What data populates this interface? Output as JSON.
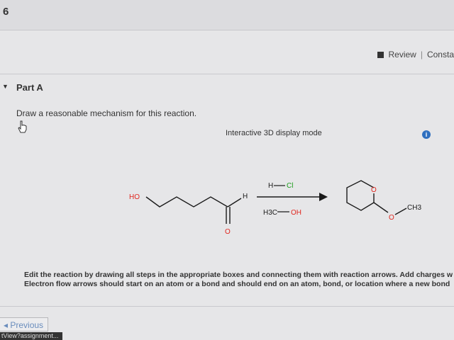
{
  "header": {
    "step_number": "6"
  },
  "toolbar": {
    "review_label": "Review",
    "separator": "|",
    "constants_label": "Consta"
  },
  "part": {
    "title": "Part A"
  },
  "question": {
    "text": "Draw a reasonable mechanism for this reaction."
  },
  "display": {
    "mode_label": "Interactive 3D display mode",
    "info_glyph": "i"
  },
  "reaction": {
    "reactant": {
      "hydroxyl": "HO",
      "aldehyde_h": "H",
      "carbonyl_o": "O"
    },
    "reagents": {
      "top_h": "H",
      "top_cl": "Cl",
      "bottom_h3c": "H3C",
      "bottom_oh": "OH"
    },
    "product": {
      "ring_o": "O",
      "ether_o": "O",
      "methyl": "CH3"
    },
    "colors": {
      "oxygen": "#e0261e",
      "chlorine": "#1a9c1a",
      "bond": "#1a1a1a"
    }
  },
  "instructions": {
    "line1": "Edit the reaction by drawing all steps in the appropriate boxes and connecting them with reaction arrows. Add charges w",
    "line2": "Electron flow arrows should start on an atom or a bond and should end on an atom, bond, or location where a new bond"
  },
  "nav": {
    "previous_label": "◂ Previous"
  },
  "status": {
    "url_text": "tView?assignment..."
  }
}
